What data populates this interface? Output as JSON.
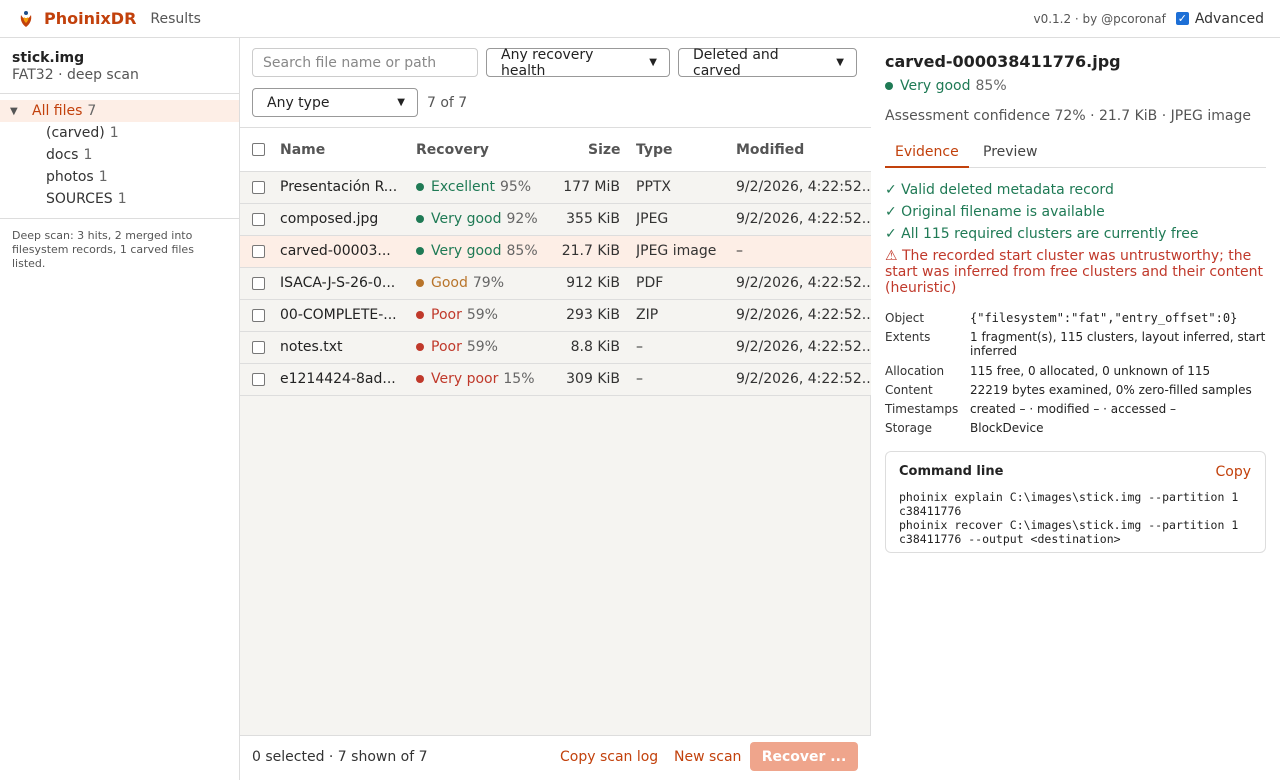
{
  "app": {
    "brand": "PhoinixDR",
    "crumb": "Results",
    "version": "v0.1.2 · by @pcoronaf",
    "advanced_label": "Advanced",
    "advanced_checked": true
  },
  "sidebar": {
    "disk_name": "stick.img",
    "disk_sub": "FAT32 · deep scan",
    "tree": [
      {
        "label": "All files",
        "count": "7",
        "active": true
      },
      {
        "label": "(carved)",
        "count": "1"
      },
      {
        "label": "docs",
        "count": "1"
      },
      {
        "label": "photos",
        "count": "1"
      },
      {
        "label": "SOURCES",
        "count": "1"
      }
    ],
    "scan_note": "Deep scan: 3 hits, 2 merged into filesystem records, 1 carved files listed."
  },
  "filters": {
    "search_placeholder": "Search file name or path",
    "health": "Any recovery health",
    "scope": "Deleted and carved",
    "type": "Any type",
    "shown": "7 of 7"
  },
  "table": {
    "headers": {
      "name": "Name",
      "recovery": "Recovery",
      "size": "Size",
      "type": "Type",
      "modified": "Modified"
    },
    "rows": [
      {
        "name": "Presentación R...",
        "health": "Excellent",
        "pct": "95%",
        "size": "177 MiB",
        "type": "PPTX",
        "modified": "9/2/2026, 4:22:52..."
      },
      {
        "name": "composed.jpg",
        "health": "Very good",
        "pct": "92%",
        "size": "355 KiB",
        "type": "JPEG",
        "modified": "9/2/2026, 4:22:52..."
      },
      {
        "name": "carved-00003...",
        "health": "Very good",
        "pct": "85%",
        "size": "21.7 KiB",
        "type": "JPEG image",
        "modified": "–"
      },
      {
        "name": "ISACA-J-S-26-0...",
        "health": "Good",
        "pct": "79%",
        "size": "912 KiB",
        "type": "PDF",
        "modified": "9/2/2026, 4:22:52..."
      },
      {
        "name": "00-COMPLETE-...",
        "health": "Poor",
        "pct": "59%",
        "size": "293 KiB",
        "type": "ZIP",
        "modified": "9/2/2026, 4:22:52..."
      },
      {
        "name": "notes.txt",
        "health": "Poor",
        "pct": "59%",
        "size": "8.8 KiB",
        "type": "–",
        "modified": "9/2/2026, 4:22:52..."
      },
      {
        "name": "e1214424-8ad...",
        "health": "Very poor",
        "pct": "15%",
        "size": "309 KiB",
        "type": "–",
        "modified": "9/2/2026, 4:22:52..."
      }
    ]
  },
  "health_colors": {
    "Excellent": "#1f7a55",
    "Very good": "#1f7a55",
    "Good": "#b8742a",
    "Poor": "#c0392b",
    "Very poor": "#c0392b"
  },
  "footer": {
    "selected": "0 selected · 7 shown of 7",
    "copy_log": "Copy scan log",
    "new_scan": "New scan",
    "recover": "Recover ..."
  },
  "detail": {
    "title": "carved-000038411776.jpg",
    "health": "Very good",
    "pct": "85%",
    "confidence": "Assessment confidence 72% · 21.7 KiB · JPEG image",
    "tab_evidence": "Evidence",
    "tab_preview": "Preview",
    "evidence_ok": [
      "✓ Valid deleted metadata record",
      "✓ Original filename is available",
      "✓ All 115 required clusters are currently free"
    ],
    "evidence_warn": "⚠ The recorded start cluster was untrustworthy; the start was inferred from free clusters and their content (heuristic)",
    "props": {
      "object_k": "Object",
      "object_v": "{\"filesystem\":\"fat\",\"entry_offset\":0}",
      "extents_k": "Extents",
      "extents_v": "1 fragment(s), 115 clusters, layout inferred, start inferred",
      "allocation_k": "Allocation",
      "allocation_v": "115 free, 0 allocated, 0 unknown of 115",
      "content_k": "Content",
      "content_v": "22219 bytes examined, 0% zero-filled samples",
      "timestamps_k": "Timestamps",
      "timestamps_v": "created – · modified – · accessed –",
      "storage_k": "Storage",
      "storage_v": "BlockDevice"
    },
    "cmd_title": "Command line",
    "cmd_copy": "Copy",
    "cmd_text": "phoinix explain C:\\images\\stick.img --partition 1 c38411776\nphoinix recover C:\\images\\stick.img --partition 1 c38411776 --output <destination>"
  }
}
